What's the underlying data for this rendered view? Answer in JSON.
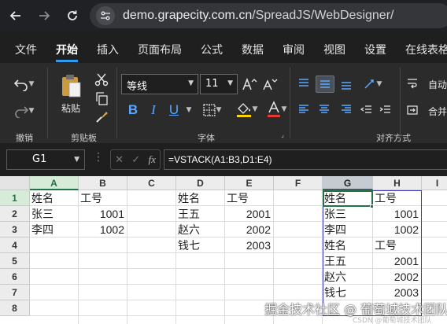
{
  "browser": {
    "url_host": "demo.grapecity.com.cn",
    "url_path": "/SpreadJS/WebDesigner/"
  },
  "menu": {
    "items": [
      "文件",
      "开始",
      "插入",
      "页面布局",
      "公式",
      "数据",
      "审阅",
      "视图",
      "设置",
      "在线表格"
    ],
    "active": "开始",
    "accent": "#2e9cf0"
  },
  "ribbon": {
    "groups": {
      "undo": "撤销",
      "clipboard": "剪贴板",
      "font": "字体",
      "alignment": "对齐方式"
    },
    "paste_label": "粘贴",
    "font_name": "等线",
    "font_size": "11",
    "auto_wrap_label": "自动",
    "merge_label": "合并",
    "font_color": "#e03c31",
    "fill_color": "#ffd400"
  },
  "formula_bar": {
    "cell_ref": "G1",
    "formula": "=VSTACK(A1:B3,D1:E4)"
  },
  "grid": {
    "columns": [
      "A",
      "B",
      "C",
      "D",
      "E",
      "F",
      "G",
      "H",
      "I"
    ],
    "rows": [
      "1",
      "2",
      "3",
      "4",
      "5",
      "6",
      "7",
      "8"
    ],
    "cells": {
      "A1": "姓名",
      "B1": "工号",
      "A2": "张三",
      "B2": "1001",
      "A3": "李四",
      "B3": "1002",
      "D1": "姓名",
      "E1": "工号",
      "D2": "王五",
      "E2": "2001",
      "D3": "赵六",
      "E3": "2002",
      "D4": "钱七",
      "E4": "2003",
      "G1": "姓名",
      "H1": "工号",
      "G2": "张三",
      "H2": "1001",
      "G3": "李四",
      "H3": "1002",
      "G4": "姓名",
      "H4": "工号",
      "G5": "王五",
      "H5": "2001",
      "G6": "赵六",
      "H6": "2002",
      "G7": "钱七",
      "H7": "2003"
    },
    "active_cell": "G1",
    "selection_color": "#217346",
    "spill_color": "#3b3bb0"
  },
  "watermark": {
    "text": "掘金技术社区 @ 葡萄城技术团队",
    "subtext": "CSDN @葡萄城技术团队"
  }
}
